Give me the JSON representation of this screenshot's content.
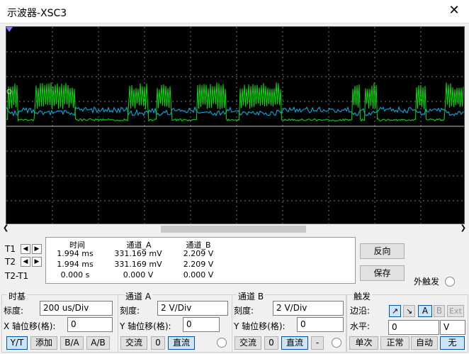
{
  "window": {
    "title": "示波器-XSC3"
  },
  "readout": {
    "headers": [
      "时间",
      "通道_A",
      "通道_B"
    ],
    "rows": [
      {
        "label": "T1",
        "time": "1.994 ms",
        "a": "331.169 mV",
        "b": "2.209 V"
      },
      {
        "label": "T2",
        "time": "1.994 ms",
        "a": "331.169 mV",
        "b": "2.209 V"
      },
      {
        "label": "T2-T1",
        "time": "0.000 s",
        "a": "0.000 V",
        "b": "0.000 V"
      }
    ]
  },
  "buttons": {
    "reverse": "反向",
    "save": "保存",
    "ext_trigger": "外触发"
  },
  "timebase": {
    "title": "时基",
    "scale_label": "标度:",
    "scale_value": "200 us/Div",
    "xpos_label": "X 轴位移(格):",
    "xpos_value": "0",
    "modes": [
      "Y/T",
      "添加",
      "B/A",
      "A/B"
    ],
    "selected_mode": "Y/T"
  },
  "channel_a": {
    "title": "通道 A",
    "scale_label": "刻度:",
    "scale_value": "2  V/Div",
    "ypos_label": "Y 轴位移(格):",
    "ypos_value": "0",
    "coupling": [
      "交流",
      "0",
      "直流"
    ],
    "selected_coupling": "直流"
  },
  "channel_b": {
    "title": "通道 B",
    "scale_label": "刻度:",
    "scale_value": "2  V/Div",
    "ypos_label": "Y 轴位移(格):",
    "ypos_value": "0",
    "coupling": [
      "交流",
      "0",
      "直流",
      "-"
    ],
    "selected_coupling": "直流"
  },
  "trigger": {
    "title": "触发",
    "edge_label": "边沿:",
    "edge_buttons": [
      "A",
      "B",
      "Ext"
    ],
    "selected_source": "A",
    "level_label": "水平:",
    "level_value": "0",
    "level_unit": "V",
    "modes": [
      "单次",
      "正常",
      "自动",
      "无"
    ],
    "selected_mode": "无"
  },
  "colors": {
    "channel_a": "#00e000",
    "channel_b": "#00b7f0",
    "screen": "#000000"
  }
}
